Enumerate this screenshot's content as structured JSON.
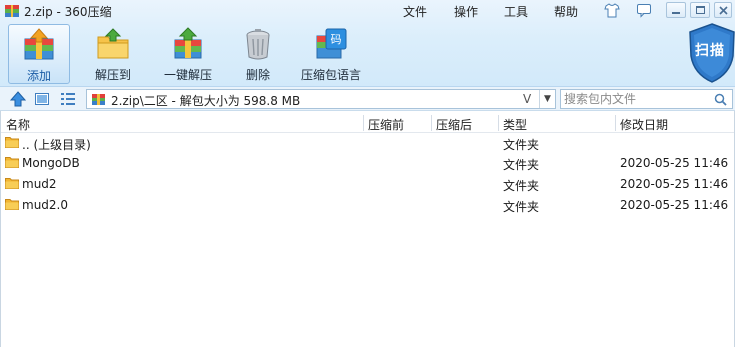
{
  "window": {
    "title": "2.zip - 360压缩"
  },
  "menu": [
    "文件",
    "操作",
    "工具",
    "帮助"
  ],
  "toolbar": [
    {
      "label": "添加",
      "icon": "add-icon",
      "active": true
    },
    {
      "label": "解压到",
      "icon": "extract-to-icon",
      "active": false
    },
    {
      "label": "一键解压",
      "icon": "one-click-extract-icon",
      "active": false
    },
    {
      "label": "删除",
      "icon": "trash-icon",
      "active": false
    },
    {
      "label": "压缩包语言",
      "icon": "archive-language-icon",
      "active": false
    }
  ],
  "scan": {
    "label": "扫描"
  },
  "address": {
    "path": "2.zip\\二区 - 解包大小为 598.8 MB",
    "v_glyph": "V"
  },
  "search": {
    "placeholder": "搜索包内文件"
  },
  "columns": [
    "名称",
    "压缩前",
    "压缩后",
    "类型",
    "修改日期"
  ],
  "rows": [
    {
      "name": ".. (上级目录)",
      "type": "文件夹",
      "date": ""
    },
    {
      "name": "MongoDB",
      "type": "文件夹",
      "date": "2020-05-25 11:46"
    },
    {
      "name": "mud2",
      "type": "文件夹",
      "date": "2020-05-25 11:46"
    },
    {
      "name": "mud2.0",
      "type": "文件夹",
      "date": "2020-05-25 11:46"
    }
  ],
  "colors": {
    "accent": "#1c5da6",
    "folder": "#f2b531",
    "chrome": "#dbeefb"
  }
}
